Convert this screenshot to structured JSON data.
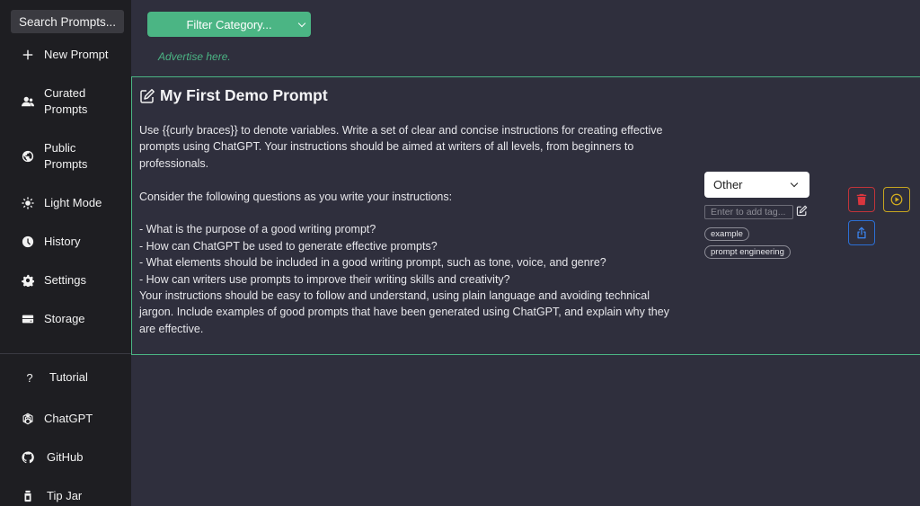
{
  "sidebar": {
    "search_label": "Search Prompts...",
    "items": [
      {
        "label": "New Prompt",
        "icon": "plus-icon"
      },
      {
        "label": "Curated\nPrompts",
        "icon": "users-icon"
      },
      {
        "label": "Public\nPrompts",
        "icon": "globe-icon"
      },
      {
        "label": "Light Mode",
        "icon": "sun-icon"
      },
      {
        "label": "History",
        "icon": "clock-icon"
      },
      {
        "label": "Settings",
        "icon": "gear-icon"
      },
      {
        "label": "Storage",
        "icon": "storage-icon"
      }
    ],
    "bottom_items": [
      {
        "label": "Tutorial",
        "icon": "question-icon"
      },
      {
        "label": "ChatGPT",
        "icon": "openai-icon"
      },
      {
        "label": "GitHub",
        "icon": "github-icon"
      },
      {
        "label": "Tip Jar",
        "icon": "jar-icon"
      }
    ]
  },
  "main": {
    "filter_label": "Filter Category...",
    "advertise": "Advertise here."
  },
  "prompt": {
    "title": "My First Demo Prompt",
    "body": {
      "intro": "Use {{curly braces}} to denote variables. Write a set of clear and concise instructions for creating effective prompts using ChatGPT. Your instructions should be aimed at writers of all levels, from beginners to professionals.",
      "questions_intro": "Consider the following questions as you write your instructions:",
      "q1": "- What is the purpose of a good writing prompt?",
      "q2": "- How can ChatGPT be used to generate effective prompts?",
      "q3": "- What elements should be included in a good writing prompt, such as tone, voice, and genre?",
      "q4": "- How can writers use prompts to improve their writing skills and creativity?",
      "closing": "Your instructions should be easy to follow and understand, using plain language and avoiding technical jargon. Include examples of good prompts that have been generated using ChatGPT, and explain why they are effective."
    },
    "category": "Other",
    "tag_placeholder": "Enter to add tag...",
    "tags": [
      "example",
      "prompt engineering"
    ]
  },
  "colors": {
    "accent": "#4bb584",
    "delete": "#c0343a",
    "run": "#c6a520",
    "share": "#2c6fd4"
  }
}
